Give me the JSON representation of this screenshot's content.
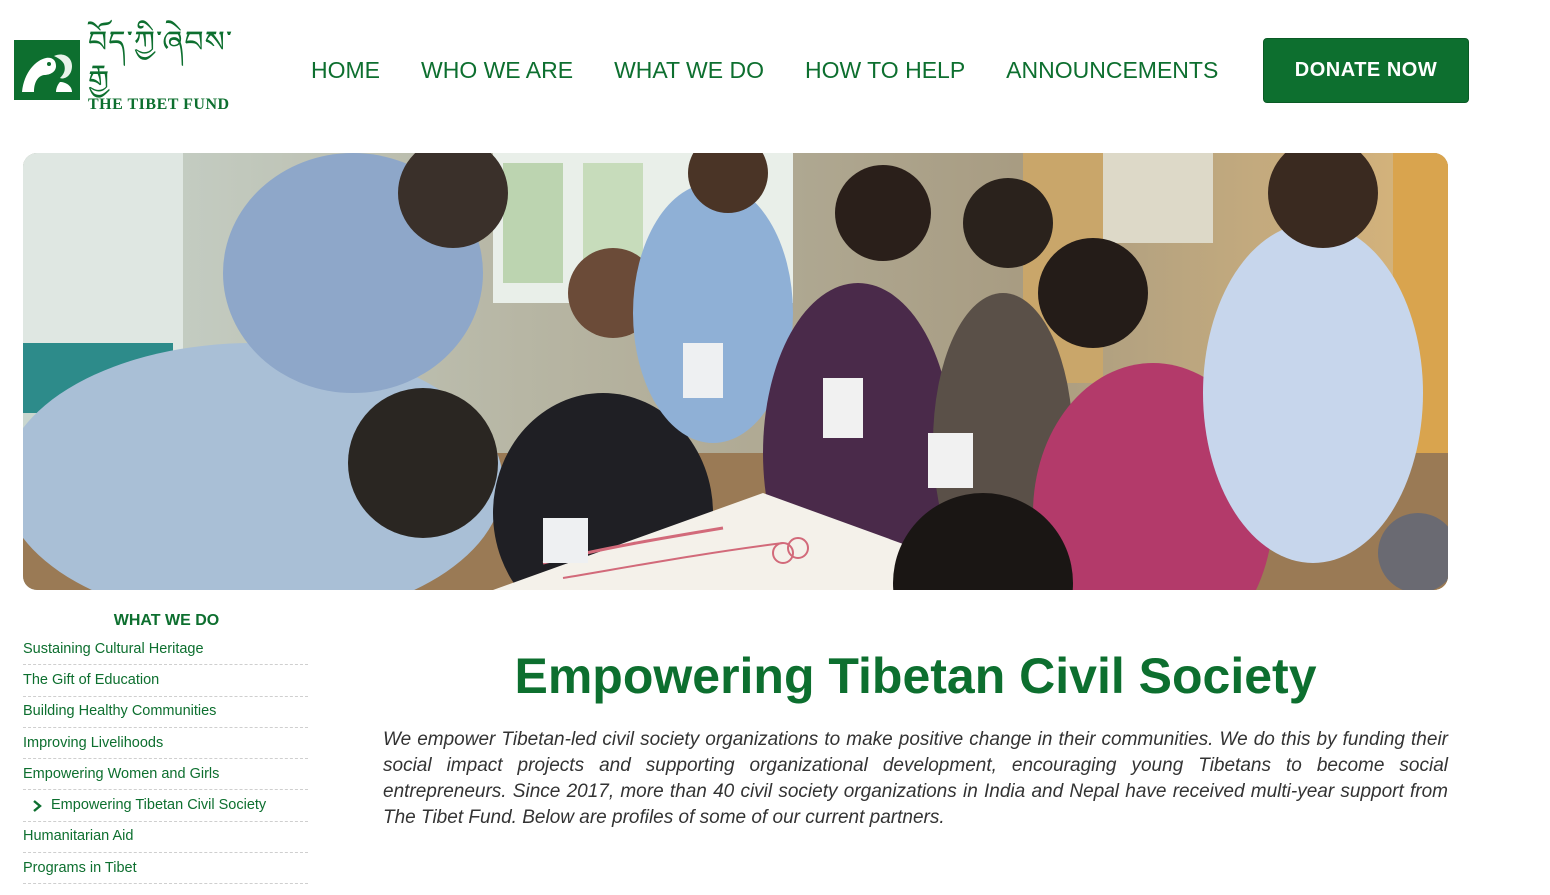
{
  "brand": {
    "tibetan": "བོད་ཀྱི་ཞེབས་རྒྱ",
    "name": "THE TIBET FUND",
    "color": "#0d6f2f"
  },
  "nav": {
    "items": [
      "HOME",
      "WHO WE ARE",
      "WHAT WE DO",
      "HOW TO HELP",
      "ANNOUNCEMENTS"
    ]
  },
  "donate": {
    "label": "DONATE NOW"
  },
  "hero": {
    "icon": "photo-workshop-group"
  },
  "sidebar": {
    "title": "WHAT WE DO",
    "items": [
      {
        "label": "Sustaining Cultural Heritage",
        "active": false
      },
      {
        "label": "The Gift of Education",
        "active": false
      },
      {
        "label": "Building Healthy Communities",
        "active": false
      },
      {
        "label": "Improving Livelihoods",
        "active": false
      },
      {
        "label": "Empowering Women and Girls",
        "active": false
      },
      {
        "label": "Empowering Tibetan Civil Society",
        "active": true
      },
      {
        "label": "Humanitarian Aid",
        "active": false
      },
      {
        "label": "Programs in Tibet",
        "active": false
      }
    ]
  },
  "main": {
    "title": "Empowering Tibetan Civil Society",
    "body": "We empower Tibetan-led civil society organizations to make positive change in their communities. We do this by funding their social impact projects and supporting organizational development, encouraging young Tibetans to become social entrepreneurs. Since 2017, more than 40 civil society organizations in India and Nepal have received multi-year support from The Tibet Fund. Below are profiles of some of our current partners."
  }
}
